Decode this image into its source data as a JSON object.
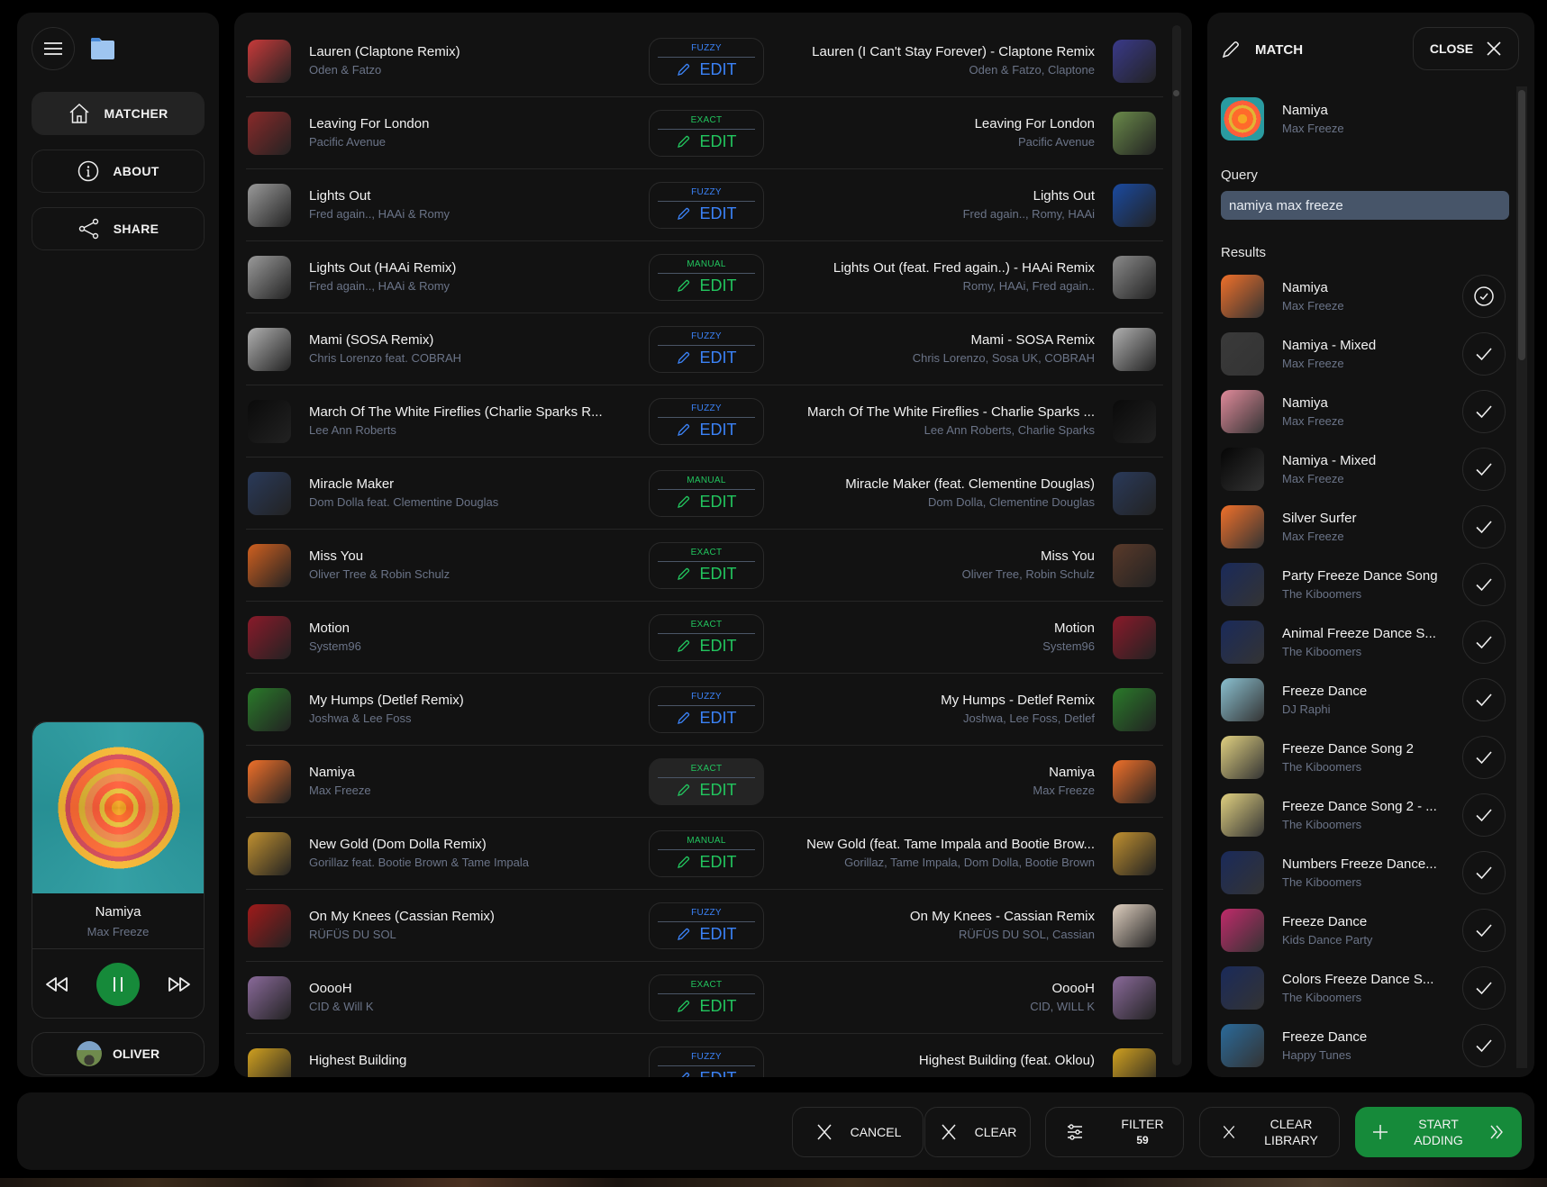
{
  "sidebar": {
    "menu_icon": "hamburger-icon",
    "folder_icon": "folder-icon",
    "nav": [
      {
        "label": "MATCHER",
        "icon": "home-icon",
        "active": true
      },
      {
        "label": "ABOUT",
        "icon": "info-icon",
        "active": false
      },
      {
        "label": "SHARE",
        "icon": "share-icon",
        "active": false
      }
    ],
    "now_playing": {
      "title": "Namiya",
      "artist": "Max Freeze",
      "playing": true
    },
    "user": {
      "name": "OLIVER"
    }
  },
  "tracks": [
    {
      "src_title": "Lauren (Claptone Remix)",
      "src_artist": "Oden & Fatzo",
      "match": "FUZZY",
      "edit": "EDIT",
      "dst_title": "Lauren (I Can't Stay Forever) - Claptone Remix",
      "dst_artist": "Oden & Fatzo, Claptone",
      "art_l": "#c83a3a",
      "art_r": "#3a3a8a"
    },
    {
      "src_title": "Leaving For London",
      "src_artist": "Pacific Avenue",
      "match": "EXACT",
      "edit": "EDIT",
      "dst_title": "Leaving For London",
      "dst_artist": "Pacific Avenue",
      "art_l": "#8a2a2a",
      "art_r": "#6a8a4a"
    },
    {
      "src_title": "Lights Out",
      "src_artist": "Fred again.., HAAi & Romy",
      "match": "FUZZY",
      "edit": "EDIT",
      "dst_title": "Lights Out",
      "dst_artist": "Fred again.., Romy, HAAi",
      "art_l": "#9a9a9a",
      "art_r": "#1a4aa0"
    },
    {
      "src_title": "Lights Out (HAAi Remix)",
      "src_artist": "Fred again.., HAAi & Romy",
      "match": "MANUAL",
      "edit": "EDIT",
      "dst_title": "Lights Out (feat. Fred again..) - HAAi Remix",
      "dst_artist": "Romy, HAAi, Fred again..",
      "art_l": "#9a9a9a",
      "art_r": "#8a8a8a"
    },
    {
      "src_title": "Mami (SOSA Remix)",
      "src_artist": "Chris Lorenzo feat. COBRAH",
      "match": "FUZZY",
      "edit": "EDIT",
      "dst_title": "Mami - SOSA Remix",
      "dst_artist": "Chris Lorenzo, Sosa UK, COBRAH",
      "art_l": "#b0b0b0",
      "art_r": "#b0b0b0"
    },
    {
      "src_title": "March Of The White Fireflies (Charlie Sparks R...",
      "src_artist": "Lee Ann Roberts",
      "match": "FUZZY",
      "edit": "EDIT",
      "dst_title": "March Of The White Fireflies - Charlie Sparks ...",
      "dst_artist": "Lee Ann Roberts, Charlie Sparks",
      "art_l": "#0a0a0a",
      "art_r": "#0a0a0a"
    },
    {
      "src_title": "Miracle Maker",
      "src_artist": "Dom Dolla feat. Clementine Douglas",
      "match": "MANUAL",
      "edit": "EDIT",
      "dst_title": "Miracle Maker (feat. Clementine Douglas)",
      "dst_artist": "Dom Dolla, Clementine Douglas",
      "art_l": "#2a3a5a",
      "art_r": "#2a3a5a"
    },
    {
      "src_title": "Miss You",
      "src_artist": "Oliver Tree & Robin Schulz",
      "match": "EXACT",
      "edit": "EDIT",
      "dst_title": "Miss You",
      "dst_artist": "Oliver Tree, Robin Schulz",
      "art_l": "#d06020",
      "art_r": "#5a3a2a"
    },
    {
      "src_title": "Motion",
      "src_artist": "System96",
      "match": "EXACT",
      "edit": "EDIT",
      "dst_title": "Motion",
      "dst_artist": "System96",
      "art_l": "#8a1a2a",
      "art_r": "#8a1a2a"
    },
    {
      "src_title": "My Humps (Detlef Remix)",
      "src_artist": "Joshwa & Lee Foss",
      "match": "FUZZY",
      "edit": "EDIT",
      "dst_title": "My Humps - Detlef Remix",
      "dst_artist": "Joshwa, Lee Foss, Detlef",
      "art_l": "#2a7a2a",
      "art_r": "#2a7a2a"
    },
    {
      "src_title": "Namiya",
      "src_artist": "Max Freeze",
      "match": "EXACT",
      "edit": "EDIT",
      "dst_title": "Namiya",
      "dst_artist": "Max Freeze",
      "art_l": "#f0702a",
      "art_r": "#f0702a",
      "hover": true
    },
    {
      "src_title": "New Gold (Dom Dolla Remix)",
      "src_artist": "Gorillaz feat. Bootie Brown & Tame Impala",
      "match": "MANUAL",
      "edit": "EDIT",
      "dst_title": "New Gold (feat. Tame Impala and Bootie Brow...",
      "dst_artist": "Gorillaz, Tame Impala, Dom Dolla, Bootie Brown",
      "art_l": "#c09030",
      "art_r": "#c09030"
    },
    {
      "src_title": "On My Knees (Cassian Remix)",
      "src_artist": "RÜFÜS DU SOL",
      "match": "FUZZY",
      "edit": "EDIT",
      "dst_title": "On My Knees - Cassian Remix",
      "dst_artist": "RÜFÜS DU SOL, Cassian",
      "art_l": "#a01a1a",
      "art_r": "#e0d0c0"
    },
    {
      "src_title": "OoooH",
      "src_artist": "CID & Will K",
      "match": "EXACT",
      "edit": "EDIT",
      "dst_title": "OoooH",
      "dst_artist": "CID, WILL K",
      "art_l": "#8a6a9a",
      "art_r": "#8a6a9a"
    },
    {
      "src_title": "Highest Building",
      "src_artist": "",
      "match": "FUZZY",
      "edit": "EDIT",
      "dst_title": "Highest Building (feat. Oklou)",
      "dst_artist": "",
      "art_l": "#d0a020",
      "art_r": "#d0a020"
    }
  ],
  "match_colors": {
    "FUZZY": "#3b82f6",
    "EXACT": "#22c55e",
    "MANUAL": "#22c55e"
  },
  "match_panel": {
    "title": "MATCH",
    "close_label": "CLOSE",
    "current": {
      "title": "Namiya",
      "artist": "Max Freeze"
    },
    "query_label": "Query",
    "query_value": "namiya max freeze",
    "results_label": "Results",
    "results": [
      {
        "title": "Namiya",
        "artist": "Max Freeze",
        "selected": true,
        "art": "#f0702a"
      },
      {
        "title": "Namiya - Mixed",
        "artist": "Max Freeze",
        "selected": false,
        "art": "#3a3a3a"
      },
      {
        "title": "Namiya",
        "artist": "Max Freeze",
        "selected": false,
        "art": "#e08a9a"
      },
      {
        "title": "Namiya - Mixed",
        "artist": "Max Freeze",
        "selected": false,
        "art": "#050505"
      },
      {
        "title": "Silver Surfer",
        "artist": "Max Freeze",
        "selected": false,
        "art": "#f0702a"
      },
      {
        "title": "Party Freeze Dance Song",
        "artist": "The Kiboomers",
        "selected": false,
        "art": "#1a2a5a"
      },
      {
        "title": "Animal Freeze Dance S...",
        "artist": "The Kiboomers",
        "selected": false,
        "art": "#1a2a5a"
      },
      {
        "title": "Freeze Dance",
        "artist": "DJ Raphi",
        "selected": false,
        "art": "#8ac0d0"
      },
      {
        "title": "Freeze Dance Song 2",
        "artist": "The Kiboomers",
        "selected": false,
        "art": "#e0d080"
      },
      {
        "title": "Freeze Dance Song 2 - ...",
        "artist": "The Kiboomers",
        "selected": false,
        "art": "#e0d080"
      },
      {
        "title": "Numbers Freeze Dance...",
        "artist": "The Kiboomers",
        "selected": false,
        "art": "#1a2a5a"
      },
      {
        "title": "Freeze Dance",
        "artist": "Kids Dance Party",
        "selected": false,
        "art": "#c02a6a"
      },
      {
        "title": "Colors Freeze Dance S...",
        "artist": "The Kiboomers",
        "selected": false,
        "art": "#1a2a5a"
      },
      {
        "title": "Freeze Dance",
        "artist": "Happy Tunes",
        "selected": false,
        "art": "#2a6a9a"
      }
    ]
  },
  "bottom_bar": {
    "cancel_label": "CANCEL",
    "clear_label": "CLEAR",
    "filter_label": "FILTER",
    "filter_count": "59",
    "clear_library_label_1": "CLEAR",
    "clear_library_label_2": "LIBRARY",
    "start_label_1": "START",
    "start_label_2": "ADDING"
  },
  "colors": {
    "accent_green": "#168a3a",
    "muted_text": "#6b7488",
    "query_bg": "#475569"
  }
}
